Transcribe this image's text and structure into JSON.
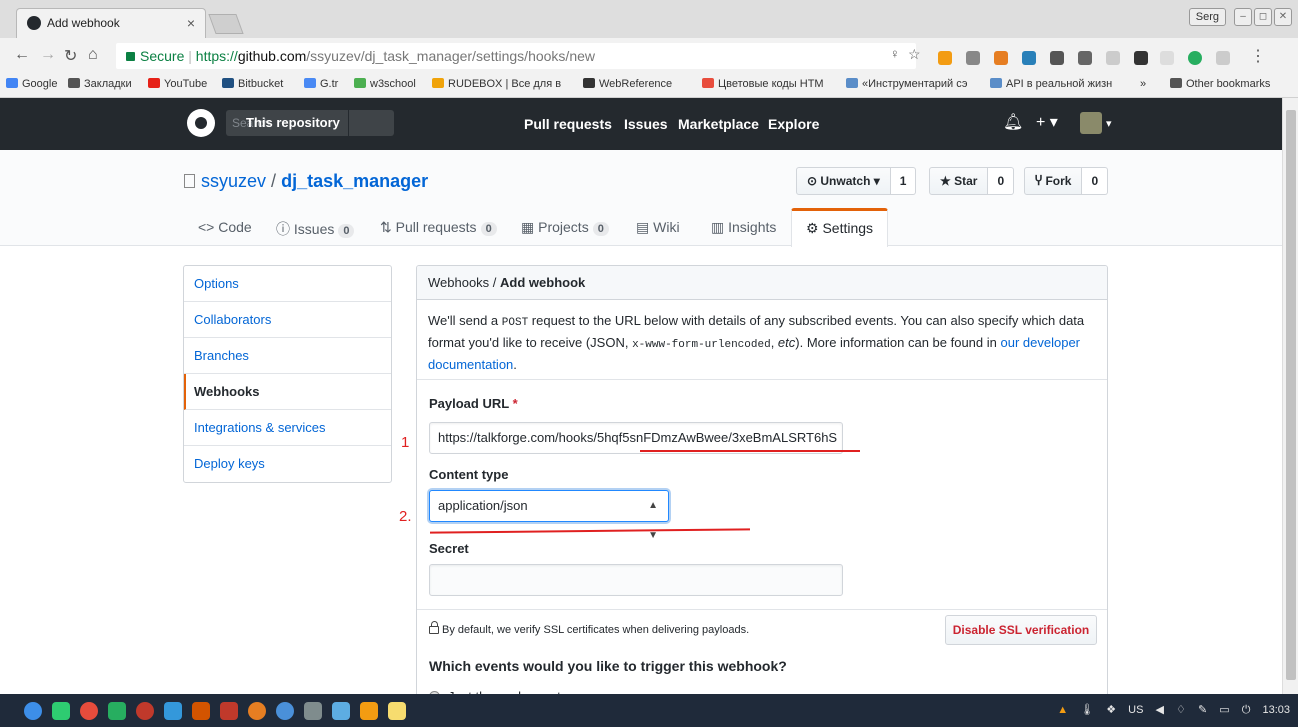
{
  "browser": {
    "tab_title": "Add webhook",
    "tab_close": "×",
    "window_user": "Serg",
    "url_secure_label": "Secure",
    "url_scheme": "https://",
    "url_host": "github.com",
    "url_path": "/ssyuzev/dj_task_manager/settings/hooks/new",
    "bookmarks": [
      {
        "label": "Google",
        "color": "#4285f4"
      },
      {
        "label": "Закладки",
        "color": "#555555"
      },
      {
        "label": "YouTube",
        "color": "#e62117"
      },
      {
        "label": "Bitbucket",
        "color": "#205081"
      },
      {
        "label": "G.tr",
        "color": "#4a8af4"
      },
      {
        "label": "w3school",
        "color": "#4caf50"
      },
      {
        "label": "RUDEBOX | Все для в",
        "color": "#f0a30a"
      },
      {
        "label": "WebReference",
        "color": "#333333"
      },
      {
        "label": "Цветовые коды HTM",
        "color": "#e84d3d"
      },
      {
        "label": "«Инструментарий сэ",
        "color": "#5a8dc8"
      },
      {
        "label": "API в реальной жизн",
        "color": "#5a8dc8"
      }
    ],
    "bookmarks_overflow": "»",
    "other_bookmarks": "Other bookmarks"
  },
  "gh_header": {
    "scope_label": "This repository",
    "search_placeholder": "Search",
    "nav": [
      "Pull requests",
      "Issues",
      "Marketplace",
      "Explore"
    ],
    "plus": "+ ▾",
    "avatar_caret": "▾"
  },
  "repo": {
    "owner": "ssyuzev",
    "separator": "/",
    "name": "dj_task_manager",
    "unwatch_label": "⊙ Unwatch ▾",
    "unwatch_count": "1",
    "star_label": "★ Star",
    "star_count": "0",
    "fork_label": "Ⴤ Fork",
    "fork_count": "0"
  },
  "repo_tabs": [
    {
      "icon": "<>",
      "label": "Code",
      "count": ""
    },
    {
      "icon": "ⓘ",
      "label": "Issues",
      "count": "0"
    },
    {
      "icon": "⇅",
      "label": "Pull requests",
      "count": "0"
    },
    {
      "icon": "▦",
      "label": "Projects",
      "count": "0"
    },
    {
      "icon": "▤",
      "label": "Wiki",
      "count": ""
    },
    {
      "icon": "▥",
      "label": "Insights",
      "count": ""
    },
    {
      "icon": "⚙",
      "label": "Settings",
      "count": ""
    }
  ],
  "settings_menu": [
    "Options",
    "Collaborators",
    "Branches",
    "Webhooks",
    "Integrations & services",
    "Deploy keys"
  ],
  "form": {
    "crumb_parent": "Webhooks",
    "crumb_sep": " / ",
    "crumb_current": "Add webhook",
    "intro_1": "We'll send a ",
    "intro_code_1": "POST",
    "intro_2": " request to the URL below with details of any subscribed events. You can also specify which data format you'd like to receive (JSON, ",
    "intro_code_2": "x-www-form-urlencoded",
    "intro_3": ", ",
    "intro_em": "etc",
    "intro_4": "). More information can be found in ",
    "intro_link": "our developer documentation",
    "intro_5": ".",
    "payload_label": "Payload URL",
    "required_mark": "*",
    "payload_value": "https://talkforge.com/hooks/5hqf5snFDmzAwBwee/3xeBmALSRT6hS",
    "content_type_label": "Content type",
    "content_type_value": "application/json",
    "secret_label": "Secret",
    "secret_value": "",
    "ssl_note": "By default, we verify SSL certificates when delivering payloads.",
    "disable_ssl_button": "Disable SSL verification",
    "events_question": "Which events would you like to trigger this webhook?",
    "event_option_1": "Just the push event."
  },
  "annotations": {
    "mark_1": "1",
    "mark_2": "2.",
    "color": "#e02020"
  },
  "taskbar": {
    "tray_layout": "US",
    "clock": "13:03"
  }
}
